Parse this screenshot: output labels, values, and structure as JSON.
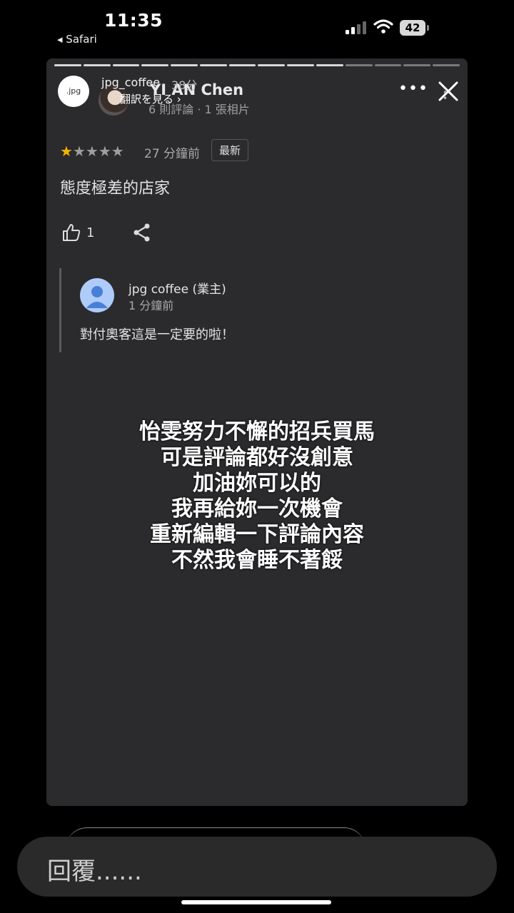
{
  "status_bar": {
    "time": "11:35",
    "back_app": "◂ Safari",
    "battery": "42"
  },
  "story": {
    "account": "jpg_coffee",
    "posted": "38分",
    "avatar_text": ".jpg"
  },
  "review": {
    "reviewer_name": "YI AN Chen",
    "translate_label": "翻訳を見る ›",
    "reviewer_meta": "6 則評論 · 1 張相片",
    "rating": 1,
    "rating_max": 5,
    "time": "27 分鐘前",
    "badge": "最新",
    "text": "態度極差的店家",
    "like_count": "1"
  },
  "owner_reply": {
    "name": "jpg coffee (業主)",
    "time": "1 分鐘前",
    "text": "對付奧客這是一定要的啦！"
  },
  "overlay_lines": [
    "怡雯努力不懈的招兵買馬",
    "可是評論都好沒創意",
    "加油妳可以的",
    "我再給妳一次機會",
    "重新編輯一下評論內容",
    "不然我會睡不著餒"
  ],
  "reply": {
    "placeholder": "回覆......"
  }
}
